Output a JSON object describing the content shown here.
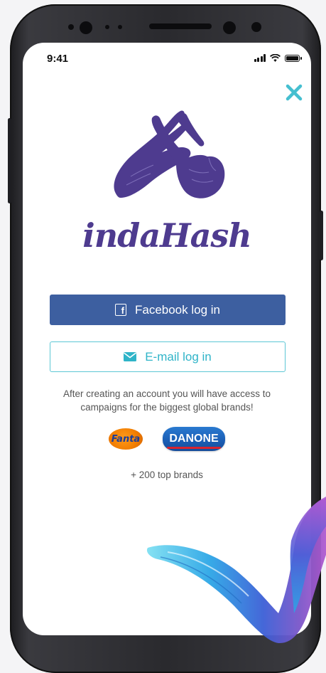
{
  "status_bar": {
    "time": "9:41"
  },
  "icons": {
    "close": "close-icon",
    "facebook": "facebook-icon",
    "email": "envelope-icon",
    "brand": "crossed-fingers-hands-icon"
  },
  "app": {
    "brand_name": "indaHash"
  },
  "buttons": {
    "facebook_label": "Facebook log in",
    "email_label": "E-mail log in"
  },
  "info_text": "After creating an account you will have access to campaigns for the biggest global brands!",
  "brands": {
    "fanta": "Fanta",
    "danone": "DANONE",
    "more": "+ 200 top brands"
  },
  "colors": {
    "brand_purple": "#4e3b8f",
    "facebook_blue": "#3d5fa0",
    "accent_teal": "#2fb4c8"
  }
}
